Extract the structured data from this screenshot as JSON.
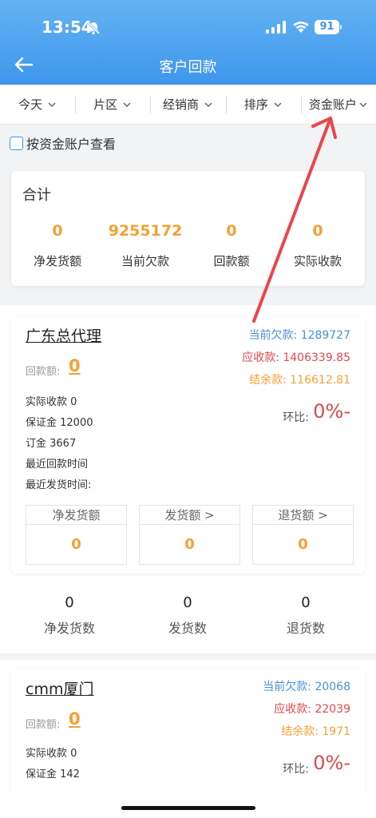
{
  "status_bar": {
    "time": "13:54",
    "battery": "91"
  },
  "header": {
    "title": "客户回款"
  },
  "filters": [
    "今天",
    "片区",
    "经销商",
    "排序",
    "资金账户"
  ],
  "account_checkbox_label": "按资金账户查看",
  "summary": {
    "title": "合计",
    "items": [
      {
        "value": "0",
        "label": "净发货额"
      },
      {
        "value": "9255172",
        "label": "当前欠款"
      },
      {
        "value": "0",
        "label": "回款额"
      },
      {
        "value": "0",
        "label": "实际收款"
      }
    ]
  },
  "dealers": [
    {
      "name": "广东总代理",
      "receipt_label": "回款额:",
      "receipt_value": "0",
      "debt": "当前欠款: 1289727",
      "receivable": "应收款: 1406339.85",
      "balance": "结余款: 116612.81",
      "ratio_label": "环比:",
      "ratio_value": "0%-",
      "info": [
        "实际收款 0",
        "保证金 12000",
        "订金 3667",
        "最近回款时间",
        "最近发货时间:"
      ],
      "boxes": [
        {
          "label": "净发货额",
          "value": "0"
        },
        {
          "label": "发货额 >",
          "value": "0"
        },
        {
          "label": "退货额 >",
          "value": "0"
        }
      ],
      "counts": [
        {
          "value": "0",
          "label": "净发货数"
        },
        {
          "value": "0",
          "label": "发货数"
        },
        {
          "value": "0",
          "label": "退货数"
        }
      ]
    },
    {
      "name": "cmm厦门",
      "receipt_label": "回款额:",
      "receipt_value": "0",
      "debt": "当前欠款: 20068",
      "receivable": "应收款: 22039",
      "balance": "结余款: 1971",
      "ratio_label": "环比:",
      "ratio_value": "0%-",
      "info": [
        "实际收款 0",
        "保证金 142"
      ]
    }
  ],
  "colors": {
    "header": "#3f96ec",
    "accent_orange": "#f5a033",
    "red": "#e04848",
    "blue": "#4a90d9",
    "annotation_arrow": "#e8474b"
  }
}
